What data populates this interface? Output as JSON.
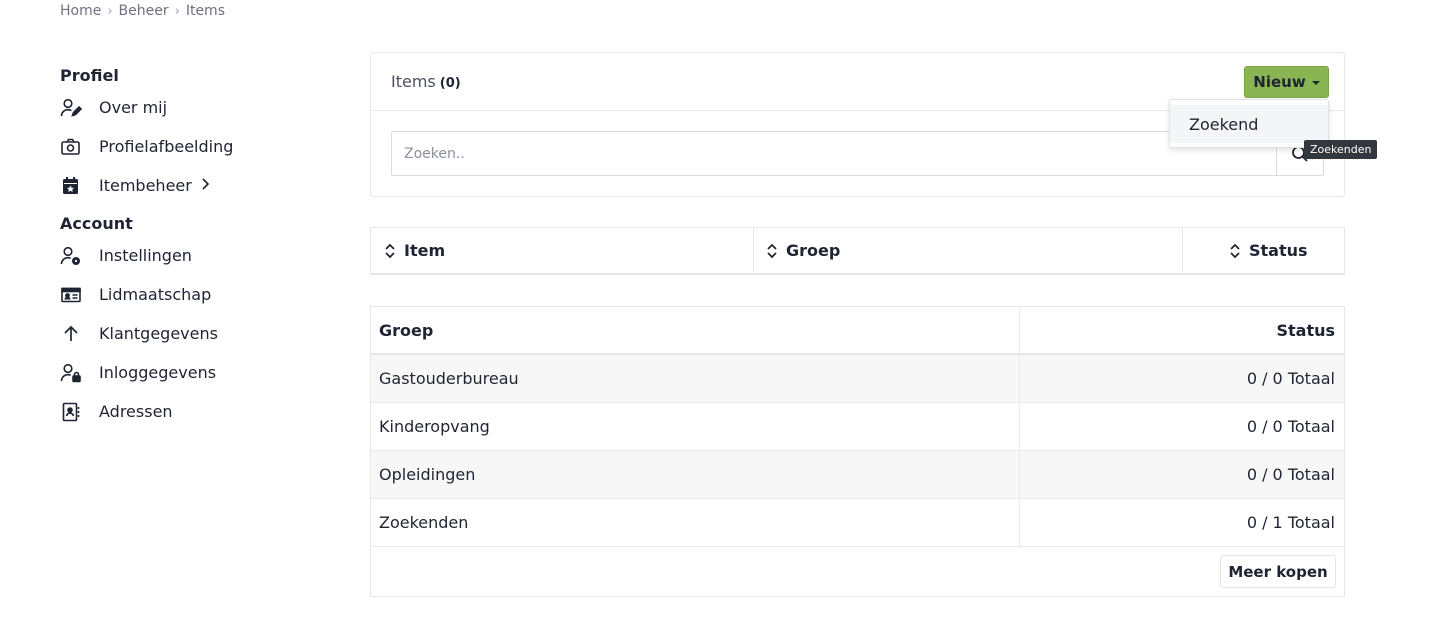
{
  "breadcrumb": [
    "Home",
    "Beheer",
    "Items"
  ],
  "sidebar": {
    "profile_heading": "Profiel",
    "profile_items": [
      {
        "label": "Over mij",
        "icon": "user-edit-icon"
      },
      {
        "label": "Profielafbeelding",
        "icon": "camera-icon"
      },
      {
        "label": "Itembeheer",
        "icon": "calendar-star-icon"
      }
    ],
    "account_heading": "Account",
    "account_items": [
      {
        "label": "Instellingen",
        "icon": "user-gear-icon"
      },
      {
        "label": "Lidmaatschap",
        "icon": "id-card-icon"
      },
      {
        "label": "Klantgegevens",
        "icon": "arrow-up-icon"
      },
      {
        "label": "Inloggegevens",
        "icon": "user-lock-icon"
      },
      {
        "label": "Adressen",
        "icon": "address-book-icon"
      }
    ]
  },
  "items_card": {
    "title": "Items",
    "count": "(0)",
    "new_button": "Nieuw",
    "search_placeholder": "Zoeken..",
    "dropdown_item": "Zoekend",
    "tooltip": "Zoekenden"
  },
  "sort_table": {
    "columns": [
      "Item",
      "Groep",
      "Status"
    ]
  },
  "group_table": {
    "headers": [
      "Groep",
      "Status"
    ],
    "rows": [
      {
        "groep": "Gastouderbureau",
        "status": "0 / 0 Totaal"
      },
      {
        "groep": "Kinderopvang",
        "status": "0 / 0 Totaal"
      },
      {
        "groep": "Opleidingen",
        "status": "0 / 0 Totaal"
      },
      {
        "groep": "Zoekenden",
        "status": "0 / 1 Totaal"
      }
    ],
    "more_button": "Meer kopen"
  },
  "colors": {
    "accent_green": "#8ab553",
    "text_dark": "#1f2433",
    "border": "#e4e6ea"
  }
}
